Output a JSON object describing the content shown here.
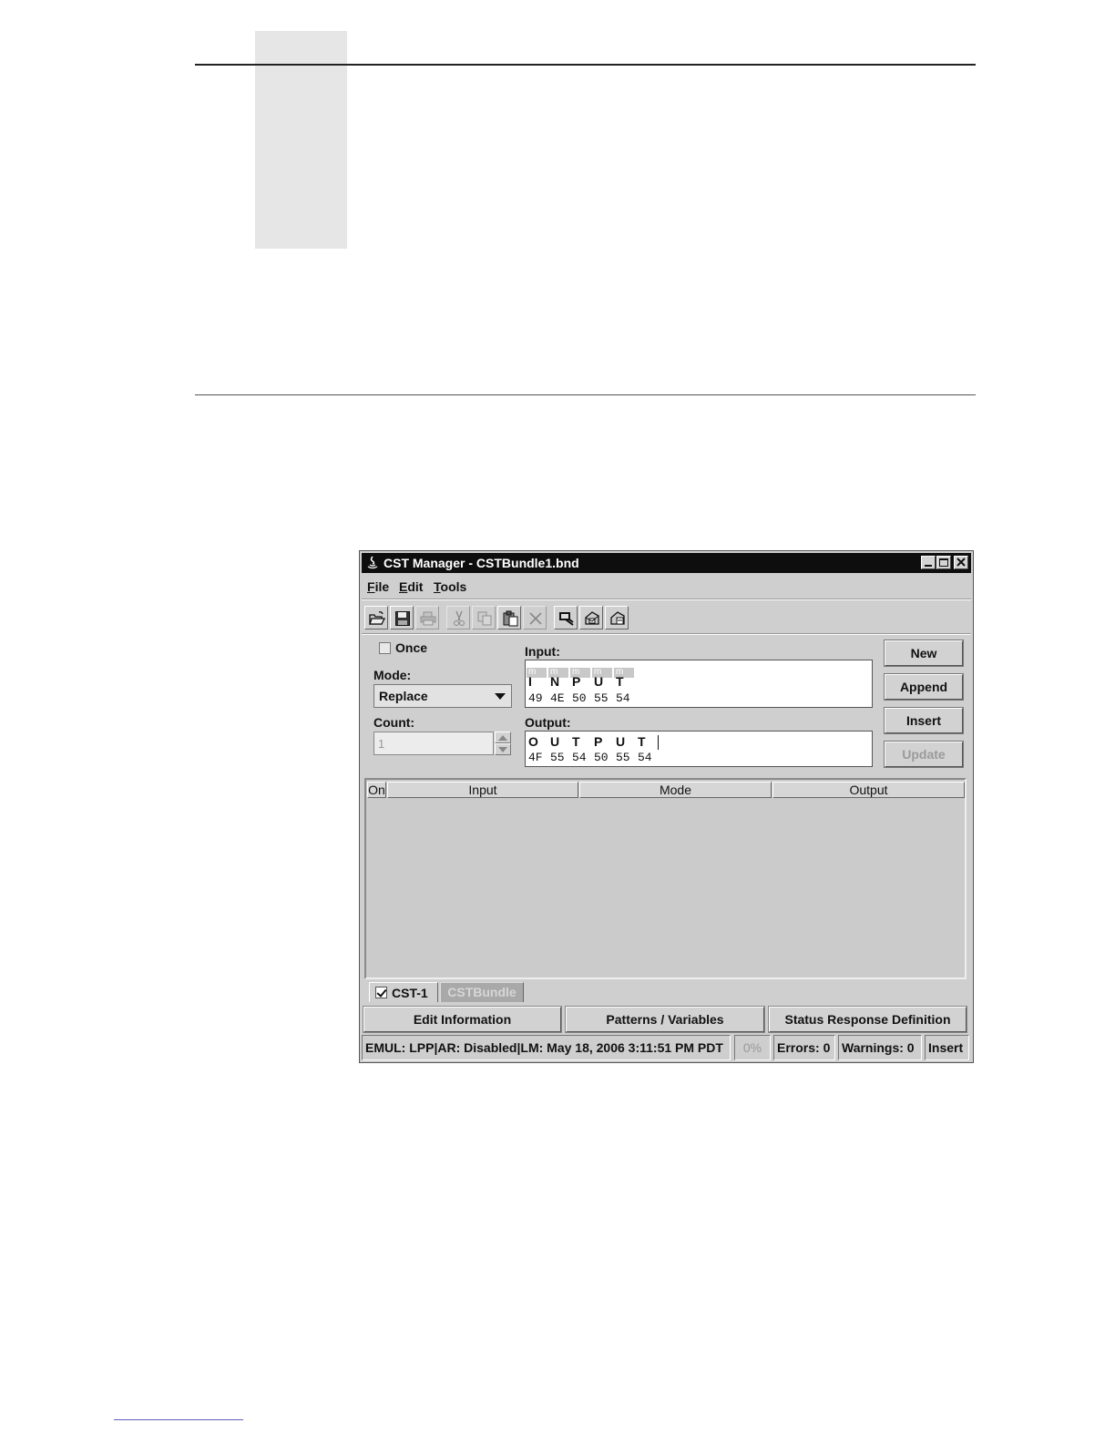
{
  "window": {
    "title": "CST Manager - CSTBundle1.bnd"
  },
  "menu": [
    {
      "accel": "F",
      "rest": "ile"
    },
    {
      "accel": "E",
      "rest": "dit"
    },
    {
      "accel": "T",
      "rest": "ools"
    }
  ],
  "toolbar": [
    {
      "icon": "open-folder-icon",
      "enabled": true
    },
    {
      "icon": "save-icon",
      "enabled": true
    },
    {
      "icon": "print-icon",
      "enabled": false
    },
    {
      "icon": "cut-icon",
      "enabled": false
    },
    {
      "icon": "copy-icon",
      "enabled": false
    },
    {
      "icon": "paste-icon",
      "enabled": true
    },
    {
      "icon": "delete-icon",
      "enabled": false
    },
    {
      "icon": "tool-a-icon",
      "enabled": true
    },
    {
      "icon": "tool-b-icon",
      "enabled": true
    },
    {
      "icon": "tool-c-icon",
      "enabled": true
    }
  ],
  "form": {
    "once_label": "Once",
    "mode_label": "Mode:",
    "mode_value": "Replace",
    "count_label": "Count:",
    "count_value": "1",
    "input_label": "Input:",
    "input_marks": [
      "m",
      "m",
      "m",
      "m",
      "m"
    ],
    "input_chars": [
      "I",
      "N",
      "P",
      "U",
      "T"
    ],
    "input_hex": [
      "49",
      "4E",
      "50",
      "55",
      "54"
    ],
    "output_label": "Output:",
    "output_chars": [
      "O",
      "U",
      "T",
      "P",
      "U",
      "T"
    ],
    "output_hex": [
      "4F",
      "55",
      "54",
      "50",
      "55",
      "54"
    ]
  },
  "buttons": {
    "new": "New",
    "append": "Append",
    "insert": "Insert",
    "update": "Update"
  },
  "table": {
    "columns": [
      "On",
      "Input",
      "Mode",
      "Output"
    ]
  },
  "tabs": {
    "active": "CST-1",
    "inactive": "CSTBundle"
  },
  "bottom_buttons": {
    "edit_info": "Edit Information",
    "patterns": "Patterns / Variables",
    "status_response": "Status Response Definition"
  },
  "statusbar": {
    "info": "EMUL: LPP|AR: Disabled|LM: May 18, 2006 3:11:51 PM PDT",
    "progress": "0%",
    "errors": "Errors: 0",
    "warnings": "Warnings: 0",
    "mode": "Insert"
  }
}
